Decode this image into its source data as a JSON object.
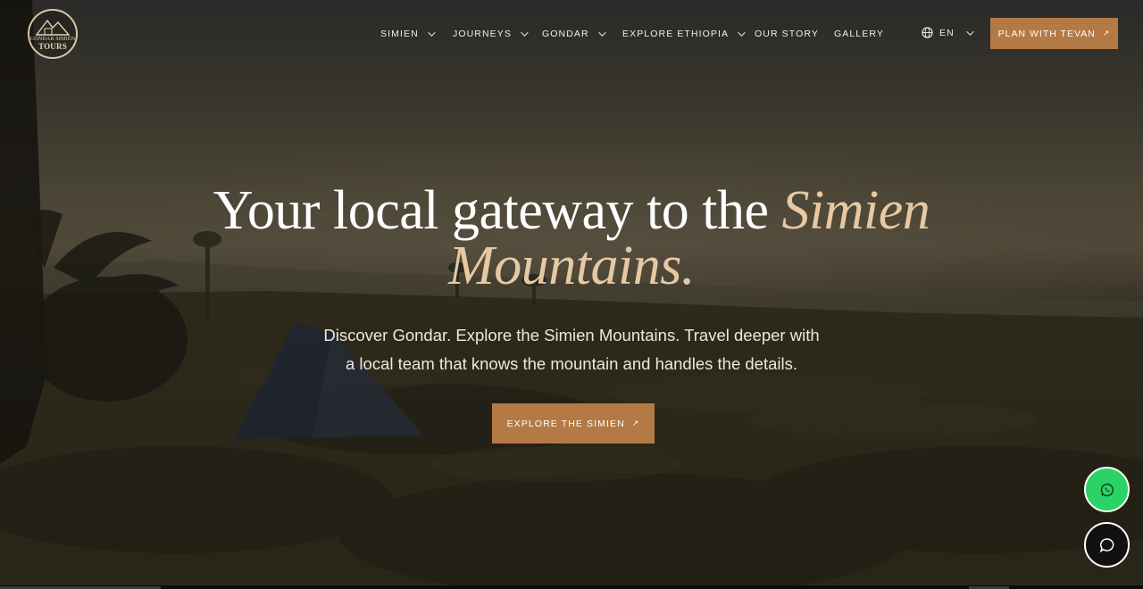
{
  "brand": {
    "logo_line1": "GONDAR SIMIEN",
    "logo_line2": "TOURS"
  },
  "nav": {
    "items": [
      {
        "label": "SIMIEN",
        "has_dropdown": true
      },
      {
        "label": "JOURNEYS",
        "has_dropdown": true
      },
      {
        "label": "GONDAR",
        "has_dropdown": true
      },
      {
        "label": "EXPLORE ETHIOPIA",
        "has_dropdown": true
      },
      {
        "label": "OUR STORY",
        "has_dropdown": false
      },
      {
        "label": "GALLERY",
        "has_dropdown": false
      }
    ],
    "language": "EN",
    "plan_button": "PLAN WITH TEVAN"
  },
  "hero": {
    "title_main": "Your local gateway to the ",
    "title_accent_1": "Simien",
    "title_accent_2": "Mountains.",
    "subtitle_line1": "Discover Gondar. Explore the Simien Mountains. Travel deeper with",
    "subtitle_line2": "a local team that knows the mountain and handles the details.",
    "cta": "EXPLORE THE SIMIEN"
  },
  "floating": {
    "whatsapp_icon": "whatsapp-icon",
    "chat_icon": "chat-bubble-icon"
  },
  "colors": {
    "accent": "#b47a45",
    "title_accent": "#e6c9a3",
    "whatsapp": "#2bd366"
  }
}
